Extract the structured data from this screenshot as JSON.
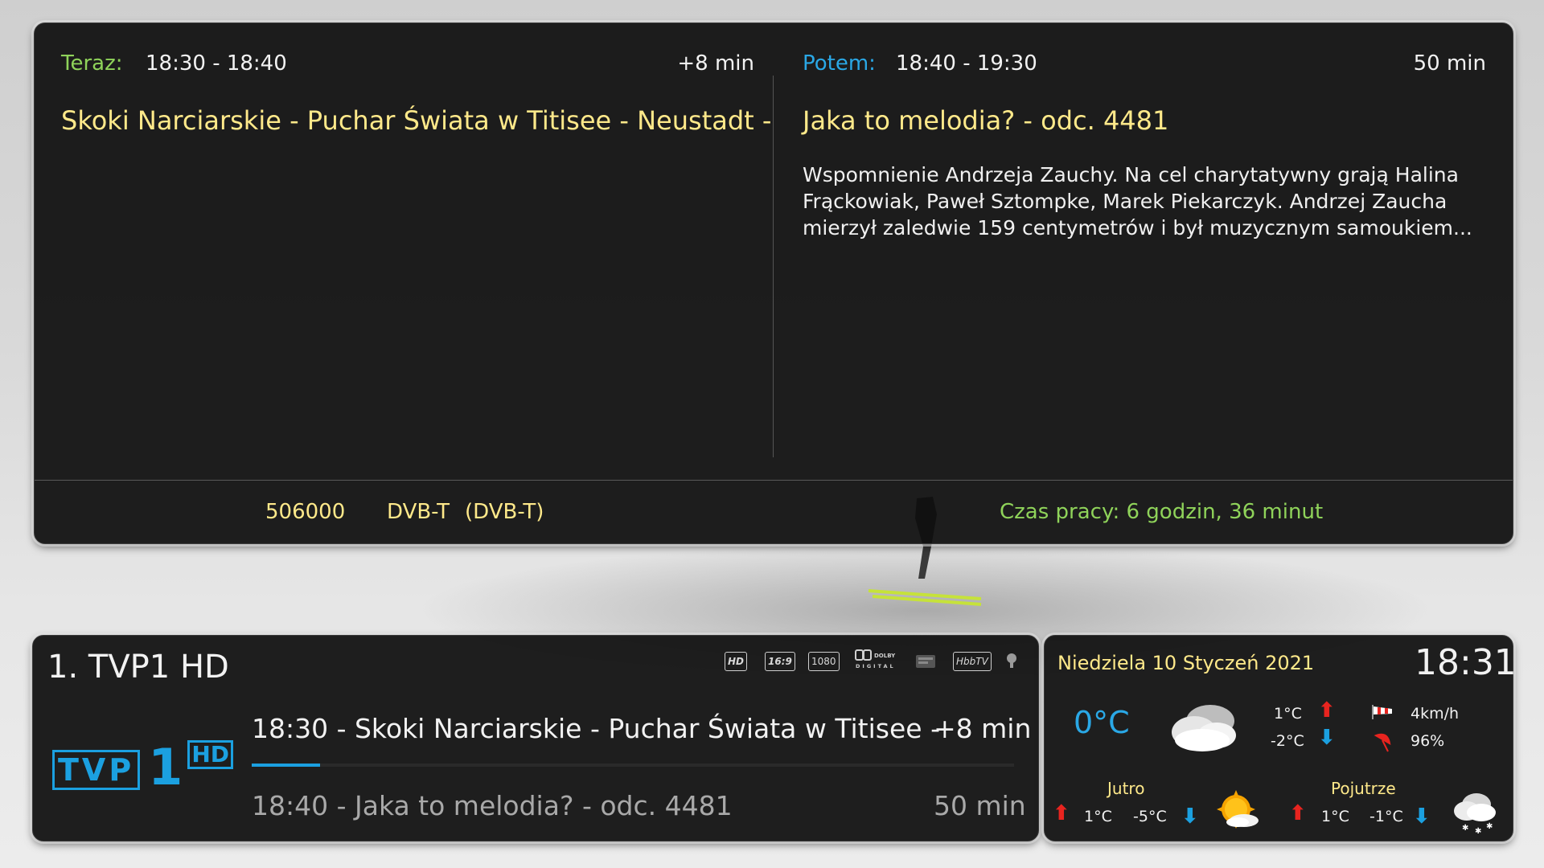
{
  "now": {
    "label": "Teraz:",
    "time": "18:30 - 18:40",
    "remaining": "+8 min",
    "title": "Skoki Narciarskie - Puchar Świata w Titisee - Neustadt -"
  },
  "next": {
    "label": "Potem:",
    "time": "18:40 - 19:30",
    "duration": "50 min",
    "title": "Jaka to melodia? - odc. 4481",
    "description": " Wspomnienie Andrzeja Zauchy. Na cel charytatywny grają Halina Frąckowiak, Paweł Sztompke, Marek Piekarczyk. Andrzej Zaucha mierzył zaledwie 159 centymetrów i był muzycznym samoukiem..."
  },
  "tuner": {
    "frequency": "506000",
    "system": "DVB-T",
    "system_paren": "(DVB-T)",
    "uptime": "Czas pracy: 6 godzin, 36 minut"
  },
  "channel": {
    "number_name": "1. TVP1 HD",
    "logo_text": "TVP",
    "logo_number": "1",
    "logo_hd": "HD",
    "features": [
      "HD",
      "16:9",
      "1080",
      "DOLBY DIGITAL",
      "HbbTV"
    ],
    "current_line": "18:30 - Skoki Narciarskie - Puchar Świata w Titisee -",
    "current_remaining": "+8 min",
    "progress_fraction": 0.09,
    "next_line": "18:40 - Jaka to melodia? - odc. 4481",
    "next_duration": "50 min"
  },
  "weather": {
    "date": "Niedziela 10 Styczeń 2021",
    "clock": "18:31",
    "temp_now": "0°C",
    "temp_high": "1°C",
    "temp_low": "-2°C",
    "wind": "4km/h",
    "humidity": "96%",
    "tomorrow": {
      "label": "Jutro",
      "high": "1°C",
      "low": "-5°C"
    },
    "day_after": {
      "label": "Pojutrze",
      "high": "1°C",
      "low": "-1°C"
    },
    "icons": {
      "now": "cloudy-icon",
      "tomorrow": "sun-cloud-icon",
      "day_after": "snow-cloud-icon"
    }
  },
  "colors": {
    "accent_blue": "#1ba0e0",
    "label_green": "#8fd35a",
    "title_yellow": "#ffe98a",
    "arrow_red": "#e8241f"
  }
}
